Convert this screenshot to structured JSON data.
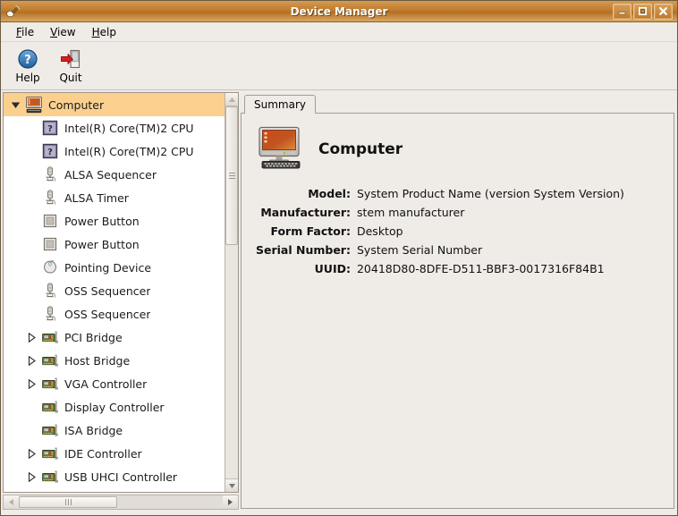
{
  "window": {
    "title": "Device Manager",
    "icon": "device-manager-icon",
    "controls": [
      {
        "name": "minimize-button",
        "glyph": "minimize"
      },
      {
        "name": "maximize-button",
        "glyph": "maximize"
      },
      {
        "name": "close-button",
        "glyph": "close"
      }
    ]
  },
  "menubar": {
    "items": [
      {
        "label": "File",
        "mnemonic": "F"
      },
      {
        "label": "View",
        "mnemonic": "V"
      },
      {
        "label": "Help",
        "mnemonic": "H"
      }
    ]
  },
  "toolbar": {
    "buttons": [
      {
        "label": "Help",
        "icon": "help-question-icon"
      },
      {
        "label": "Quit",
        "icon": "quit-door-arrow-icon"
      }
    ]
  },
  "tree": {
    "selected": "Computer",
    "items": [
      {
        "label": "Computer",
        "icon": "computer-icon",
        "depth": 0,
        "expander": "expanded",
        "selected": true
      },
      {
        "label": "Intel(R) Core(TM)2 CPU",
        "icon": "unknown-device-icon",
        "depth": 1,
        "expander": "none",
        "selected": false
      },
      {
        "label": "Intel(R) Core(TM)2 CPU",
        "icon": "unknown-device-icon",
        "depth": 1,
        "expander": "none",
        "selected": false
      },
      {
        "label": "ALSA Sequencer",
        "icon": "microphone-icon",
        "depth": 1,
        "expander": "none",
        "selected": false
      },
      {
        "label": "ALSA Timer",
        "icon": "microphone-icon",
        "depth": 1,
        "expander": "none",
        "selected": false
      },
      {
        "label": "Power Button",
        "icon": "button-square-icon",
        "depth": 1,
        "expander": "none",
        "selected": false
      },
      {
        "label": "Power Button",
        "icon": "button-square-icon",
        "depth": 1,
        "expander": "none",
        "selected": false
      },
      {
        "label": "Pointing Device",
        "icon": "mouse-icon",
        "depth": 1,
        "expander": "none",
        "selected": false
      },
      {
        "label": "OSS Sequencer",
        "icon": "microphone-icon",
        "depth": 1,
        "expander": "none",
        "selected": false
      },
      {
        "label": "OSS Sequencer",
        "icon": "microphone-icon",
        "depth": 1,
        "expander": "none",
        "selected": false
      },
      {
        "label": "PCI Bridge",
        "icon": "pci-card-icon",
        "depth": 1,
        "expander": "collapsed",
        "selected": false
      },
      {
        "label": "Host Bridge",
        "icon": "pci-card-icon",
        "depth": 1,
        "expander": "collapsed",
        "selected": false
      },
      {
        "label": "VGA Controller",
        "icon": "pci-card-icon",
        "depth": 1,
        "expander": "collapsed",
        "selected": false
      },
      {
        "label": "Display Controller",
        "icon": "pci-card-icon",
        "depth": 1,
        "expander": "none",
        "selected": false
      },
      {
        "label": "ISA Bridge",
        "icon": "pci-card-icon",
        "depth": 1,
        "expander": "none",
        "selected": false
      },
      {
        "label": "IDE Controller",
        "icon": "pci-card-icon",
        "depth": 1,
        "expander": "collapsed",
        "selected": false
      },
      {
        "label": "USB UHCI Controller",
        "icon": "pci-card-icon",
        "depth": 1,
        "expander": "collapsed",
        "selected": false
      }
    ]
  },
  "details": {
    "tabs": [
      {
        "label": "Summary",
        "active": true
      }
    ],
    "heading": "Computer",
    "heading_icon": "computer-large-icon",
    "fields": [
      {
        "label": "Model:",
        "value": "System Product Name (version System Version)"
      },
      {
        "label": "Manufacturer:",
        "value": "stem manufacturer"
      },
      {
        "label": "Form Factor:",
        "value": "Desktop"
      },
      {
        "label": "Serial Number:",
        "value": "System Serial Number"
      },
      {
        "label": "UUID:",
        "value": "20418D80-8DFE-D511-BBF3-0017316F84B1"
      }
    ]
  },
  "colors": {
    "titlebar": "#c17c2d",
    "selection": "#fbd08e",
    "panel": "#efebe7",
    "tree_bg": "#ffffff"
  }
}
